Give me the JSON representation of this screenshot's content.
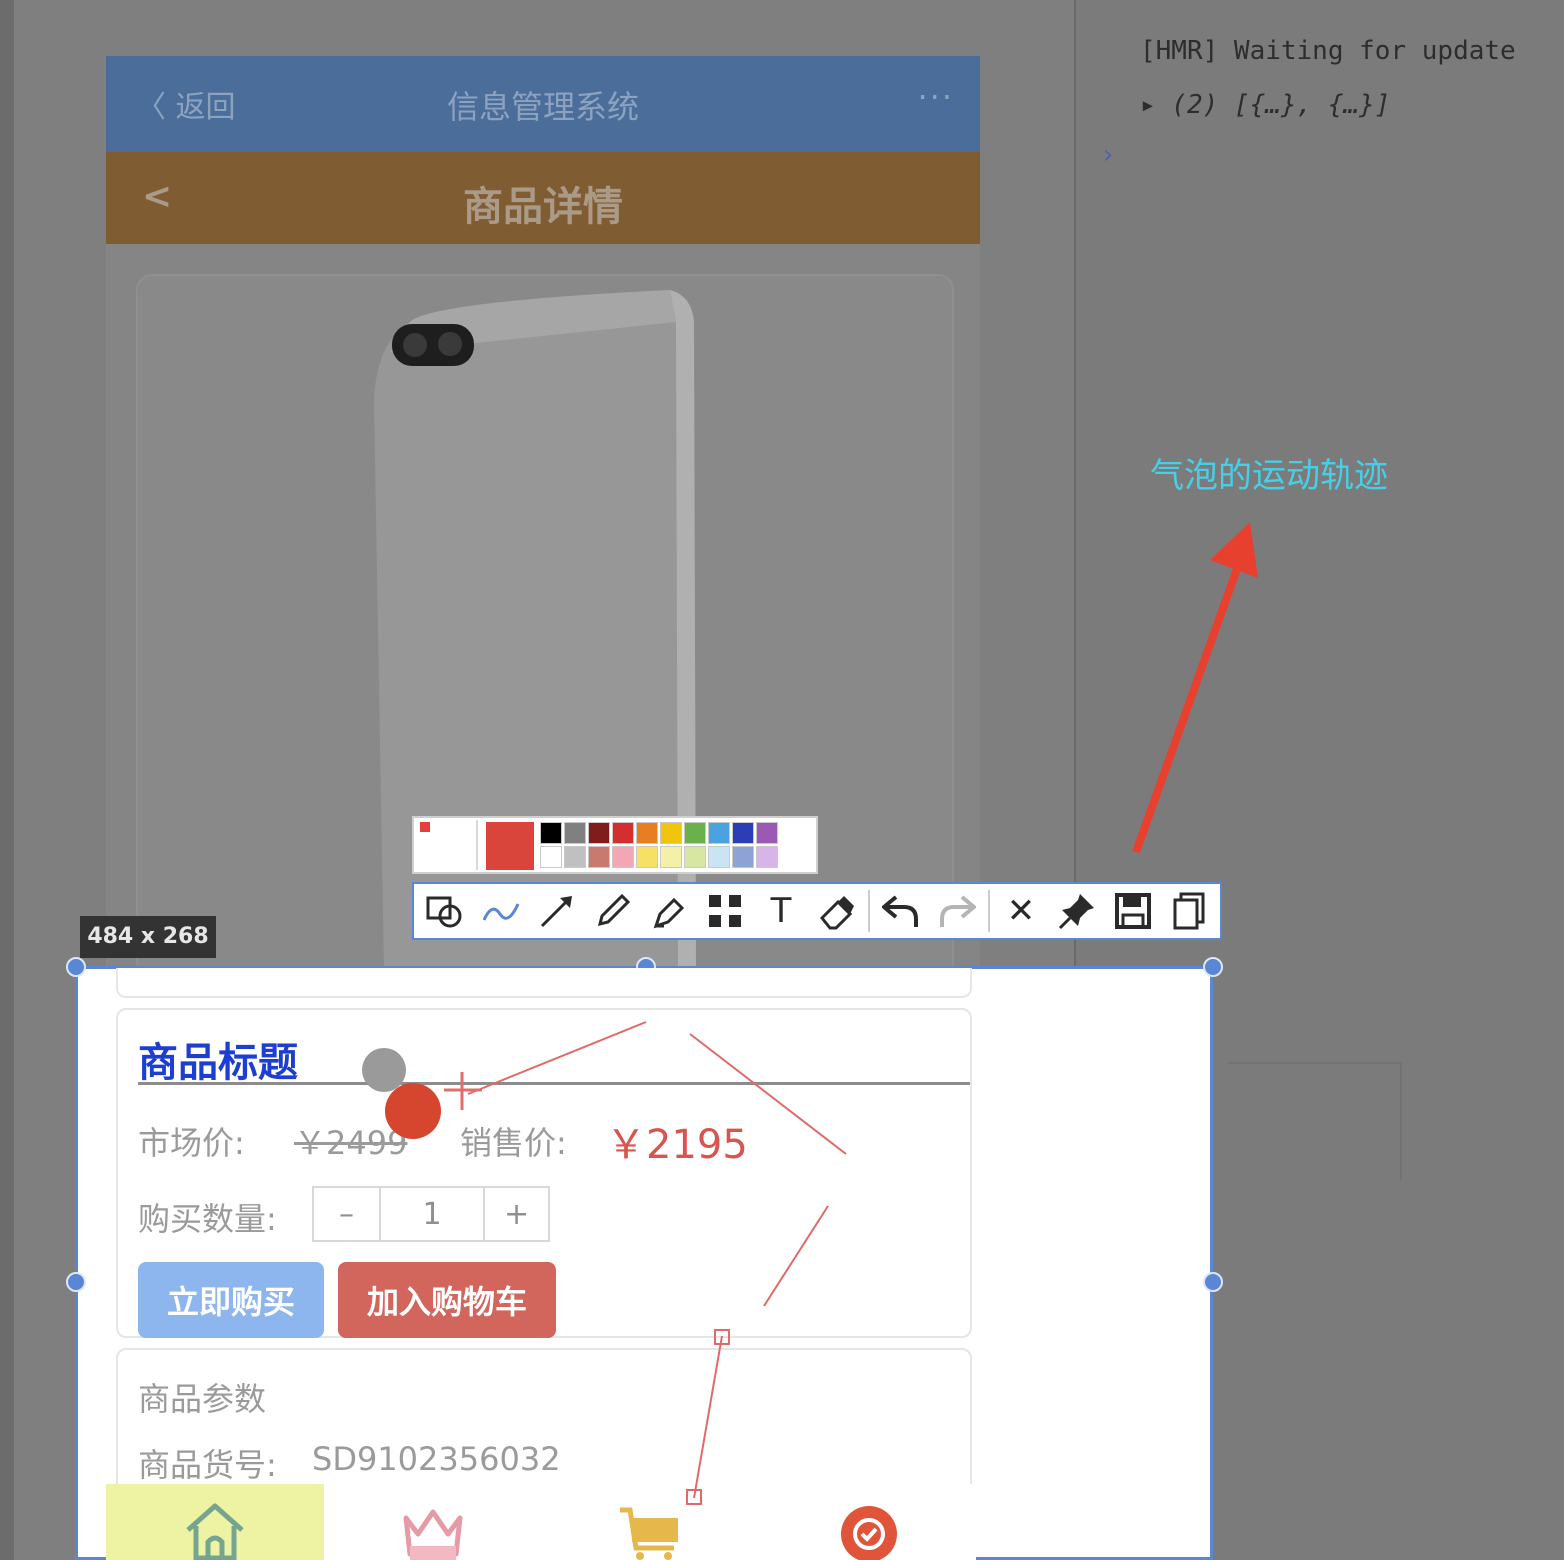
{
  "console": {
    "lines": [
      "[HMR] Waiting for update",
      "▸ (2) [{…}, {…}]"
    ],
    "prompt": "›"
  },
  "app": {
    "top_bar": {
      "back_label": "〈 返回",
      "title": "信息管理系统",
      "more": "···"
    },
    "detail_bar": {
      "back": "<",
      "title": "商品详情"
    }
  },
  "selection": {
    "size_label": "484 x 268"
  },
  "product": {
    "title": "商品标题",
    "market_price_label": "市场价:",
    "market_price": "￥2499",
    "sale_price_label": "销售价:",
    "sale_price": "￥2195",
    "quantity_label": "购买数量:",
    "quantity_minus": "–",
    "quantity_value": "1",
    "quantity_plus": "+",
    "buy_now_label": "立即购买",
    "add_to_cart_label": "加入购物车",
    "params_title": "商品参数",
    "goods_no_label": "商品货号:",
    "goods_no_value": "SD9102356032"
  },
  "tab_bar": {
    "items": [
      {
        "icon": "home-icon",
        "color": "#75a48f"
      },
      {
        "icon": "crown-icon",
        "color": "#e59aa6"
      },
      {
        "icon": "cart-icon",
        "color": "#e6b84c"
      },
      {
        "icon": "profile-icon",
        "color": "#e0553a"
      }
    ]
  },
  "annotation_toolbar": {
    "current_color": "#d9443b",
    "swatches": [
      "#000000",
      "#808080",
      "#7f1d1d",
      "#d32f2f",
      "#e67e22",
      "#f1c40f",
      "#6ab04c",
      "#4aa3df",
      "#2c3eb5",
      "#9b59b6",
      "#ffffff",
      "#c0c0c0",
      "#c97a6e",
      "#f3a6b3",
      "#f7e066",
      "#f4f0a8",
      "#d7e6a0",
      "#c9e4f2",
      "#8fa2d6",
      "#d8b4e8"
    ],
    "tools": [
      "shape-icon",
      "pen-curve-icon",
      "arrow-icon",
      "pencil-icon",
      "highlighter-icon",
      "mosaic-icon",
      "text-icon",
      "eraser-icon",
      "undo-icon",
      "redo-icon",
      "close-icon",
      "pin-icon",
      "save-icon",
      "copy-icon"
    ],
    "text_tool": "T",
    "close": "✕"
  },
  "annotation": {
    "text": "气泡的运动轨迹",
    "text_color": "#45d0e8",
    "arrow_color": "#e8402f"
  }
}
